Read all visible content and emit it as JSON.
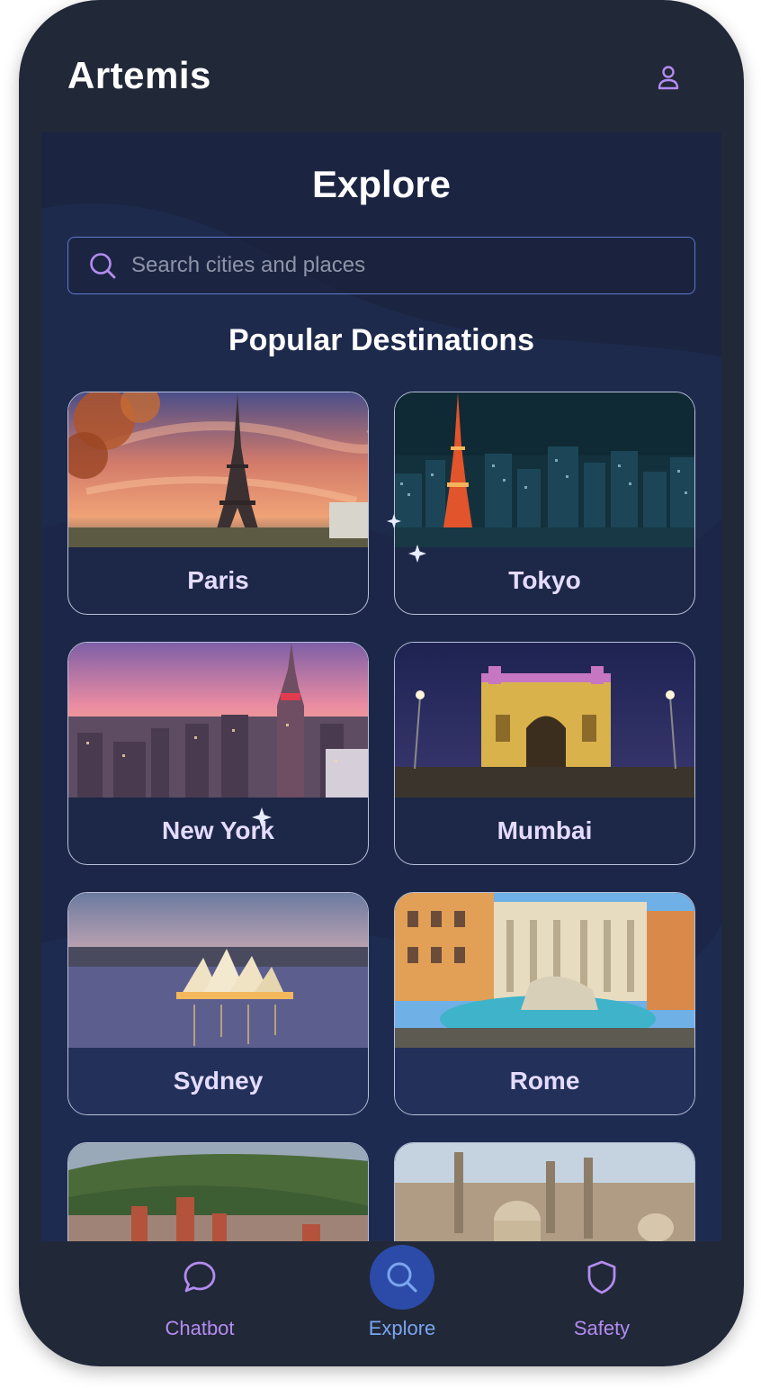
{
  "app": {
    "title": "Artemis"
  },
  "header": {
    "profile_icon": "user-icon"
  },
  "explore": {
    "title": "Explore",
    "search": {
      "placeholder": "Search cities and places",
      "value": ""
    },
    "section_title": "Popular Destinations",
    "destinations": [
      {
        "name": "Paris"
      },
      {
        "name": "Tokyo"
      },
      {
        "name": "New York"
      },
      {
        "name": "Mumbai"
      },
      {
        "name": "Sydney"
      },
      {
        "name": "Rome"
      },
      {
        "name": ""
      },
      {
        "name": ""
      }
    ]
  },
  "nav": {
    "items": [
      {
        "label": "Chatbot",
        "icon": "chat-bubble-icon",
        "active": false
      },
      {
        "label": "Explore",
        "icon": "search-icon",
        "active": true
      },
      {
        "label": "Safety",
        "icon": "shield-icon",
        "active": false
      }
    ]
  },
  "colors": {
    "phone_bg": "#212838",
    "content_bg": "#1b2542",
    "accent_purple": "#b48cf0",
    "accent_blue": "#7aa5ee",
    "active_nav_bg": "#2c4aa8",
    "card_label": "#e4dcff"
  }
}
